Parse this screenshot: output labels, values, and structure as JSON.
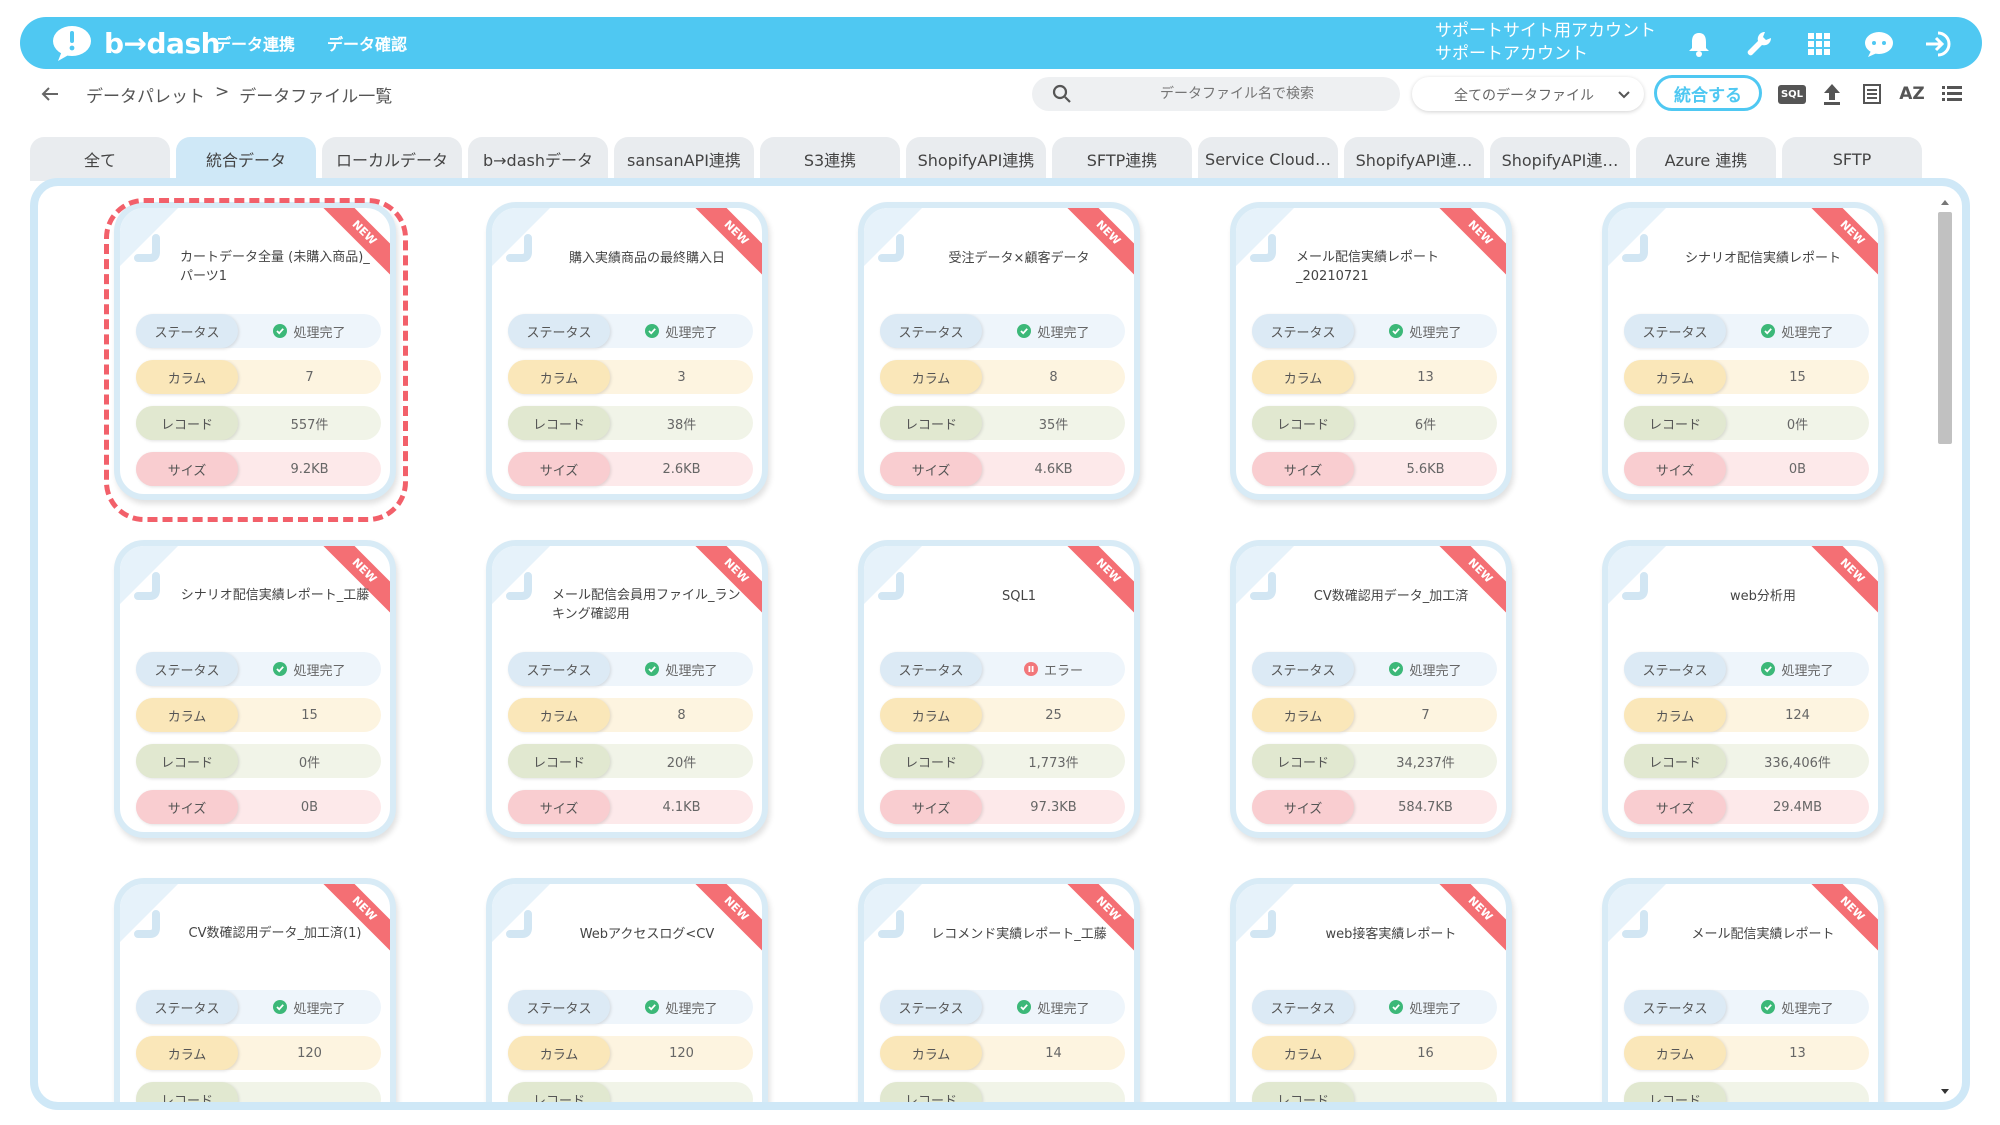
{
  "app": {
    "logo": "b→dash",
    "nav": [
      "データ連携",
      "データ確認"
    ],
    "account_line1": "サポートサイト用アカウント",
    "account_line2": "サポートアカウント",
    "brand_color": "#4fc8f2"
  },
  "toolbar": {
    "breadcrumb": [
      "データパレット",
      ">",
      "データファイル一覧"
    ],
    "search_placeholder": "データファイル名で検索",
    "filter_selected": "全てのデータファイル",
    "merge_label": "統合する",
    "sql_label": "SQL",
    "sort_label": "AZ"
  },
  "tabs": [
    {
      "label": "全て",
      "active": false
    },
    {
      "label": "統合データ",
      "active": true
    },
    {
      "label": "ローカルデータ",
      "active": false
    },
    {
      "label": "b→dashデータ",
      "active": false
    },
    {
      "label": "sansanAPI連携",
      "active": false
    },
    {
      "label": "S3連携",
      "active": false
    },
    {
      "label": "ShopifyAPI連携",
      "active": false
    },
    {
      "label": "SFTP連携",
      "active": false
    },
    {
      "label": "Service Cloud…",
      "active": false
    },
    {
      "label": "ShopifyAPI連…",
      "active": false
    },
    {
      "label": "ShopifyAPI連…",
      "active": false
    },
    {
      "label": "Azure 連携",
      "active": false
    },
    {
      "label": "SFTP",
      "active": false
    }
  ],
  "labels": {
    "status": "ステータス",
    "columns": "カラム",
    "records": "レコード",
    "size": "サイズ",
    "new_badge": "NEW"
  },
  "cards": [
    {
      "title": "カートデータ全量 (未購入商品)_パーツ1",
      "status": "処理完了",
      "status_type": "ok",
      "columns": "7",
      "records": "557件",
      "size": "9.2KB"
    },
    {
      "title": "購入実績商品の最終購入日",
      "status": "処理完了",
      "status_type": "ok",
      "columns": "3",
      "records": "38件",
      "size": "2.6KB"
    },
    {
      "title": "受注データ×顧客データ",
      "status": "処理完了",
      "status_type": "ok",
      "columns": "8",
      "records": "35件",
      "size": "4.6KB"
    },
    {
      "title": "メール配信実績レポート_20210721",
      "status": "処理完了",
      "status_type": "ok",
      "columns": "13",
      "records": "6件",
      "size": "5.6KB"
    },
    {
      "title": "シナリオ配信実績レポート",
      "status": "処理完了",
      "status_type": "ok",
      "columns": "15",
      "records": "0件",
      "size": "0B"
    },
    {
      "title": "シナリオ配信実績レポート_工藤",
      "status": "処理完了",
      "status_type": "ok",
      "columns": "15",
      "records": "0件",
      "size": "0B"
    },
    {
      "title": "メール配信会員用ファイル_ランキング確認用",
      "status": "処理完了",
      "status_type": "ok",
      "columns": "8",
      "records": "20件",
      "size": "4.1KB"
    },
    {
      "title": "SQL1",
      "status": "エラー",
      "status_type": "error",
      "columns": "25",
      "records": "1,773件",
      "size": "97.3KB"
    },
    {
      "title": "CV数確認用データ_加工済",
      "status": "処理完了",
      "status_type": "ok",
      "columns": "7",
      "records": "34,237件",
      "size": "584.7KB"
    },
    {
      "title": "web分析用",
      "status": "処理完了",
      "status_type": "ok",
      "columns": "124",
      "records": "336,406件",
      "size": "29.4MB"
    },
    {
      "title": "CV数確認用データ_加工済(1)",
      "status": "処理完了",
      "status_type": "ok",
      "columns": "120",
      "records": "",
      "size": ""
    },
    {
      "title": "Webアクセスログ<CV",
      "status": "処理完了",
      "status_type": "ok",
      "columns": "120",
      "records": "",
      "size": ""
    },
    {
      "title": "レコメンド実績レポート_工藤",
      "status": "処理完了",
      "status_type": "ok",
      "columns": "14",
      "records": "",
      "size": ""
    },
    {
      "title": "web接客実績レポート",
      "status": "処理完了",
      "status_type": "ok",
      "columns": "16",
      "records": "",
      "size": ""
    },
    {
      "title": "メール配信実績レポート",
      "status": "処理完了",
      "status_type": "ok",
      "columns": "13",
      "records": "",
      "size": ""
    }
  ],
  "colors": {
    "ok": "#3cb878",
    "error": "#f2777a",
    "new_ribbon": "#f46f74"
  }
}
